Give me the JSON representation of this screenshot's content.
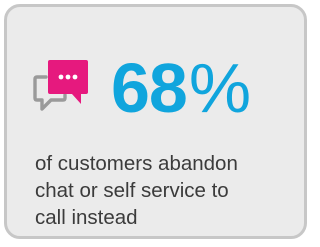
{
  "stat": {
    "number": "68",
    "unit": "%"
  },
  "caption": {
    "lines": [
      "of customers abandon",
      "chat or self service to",
      "call instead"
    ]
  },
  "icon": {
    "name": "chat-bubbles-icon",
    "accent_color": "#e6197e",
    "outline_color": "#9a9a9a"
  },
  "colors": {
    "stat": "#10a5dd",
    "text": "#3b3b3b",
    "card_background": "#ebebeb",
    "card_border": "#c7c7c7"
  }
}
